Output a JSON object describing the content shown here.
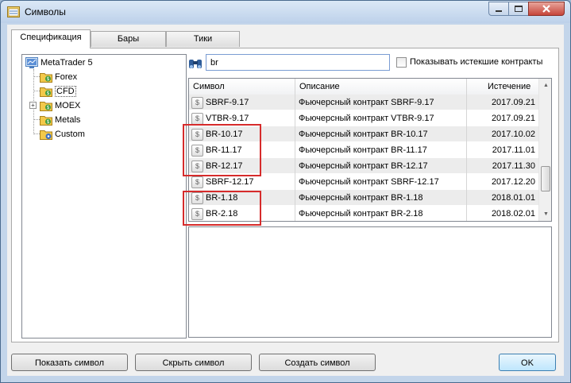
{
  "window": {
    "title": "Символы",
    "close_icon": "close-icon",
    "minimize_icon": "minimize-icon",
    "maximize_icon": "maximize-icon"
  },
  "tabs": [
    {
      "label": "Спецификация",
      "active": true
    },
    {
      "label": "Бары",
      "active": false
    },
    {
      "label": "Тики",
      "active": false
    }
  ],
  "tree": {
    "root": {
      "label": "MetaTrader 5",
      "icon": "metatrader-icon"
    },
    "items": [
      {
        "label": "Forex",
        "icon": "folder-dollar-icon",
        "expandable": false
      },
      {
        "label": "CFD",
        "icon": "folder-dollar-icon",
        "expandable": false,
        "selected": true
      },
      {
        "label": "MOEX",
        "icon": "folder-dollar-icon",
        "expandable": true
      },
      {
        "label": "Metals",
        "icon": "folder-dollar-icon",
        "expandable": false
      },
      {
        "label": "Custom",
        "icon": "folder-custom-icon",
        "expandable": false
      }
    ]
  },
  "search": {
    "value": "br",
    "icon": "binoculars-icon"
  },
  "show_expired": {
    "label": "Показывать истекшие контракты",
    "checked": false
  },
  "table": {
    "columns": [
      "Символ",
      "Описание",
      "Истечение"
    ],
    "rows": [
      {
        "symbol": "SBRF-9.17",
        "description": "Фьючерсный контракт SBRF-9.17",
        "expiration": "2017.09.21"
      },
      {
        "symbol": "VTBR-9.17",
        "description": "Фьючерсный контракт VTBR-9.17",
        "expiration": "2017.09.21"
      },
      {
        "symbol": "BR-10.17",
        "description": "Фьючерсный контракт BR-10.17",
        "expiration": "2017.10.02"
      },
      {
        "symbol": "BR-11.17",
        "description": "Фьючерсный контракт BR-11.17",
        "expiration": "2017.11.01"
      },
      {
        "symbol": "BR-12.17",
        "description": "Фьючерсный контракт BR-12.17",
        "expiration": "2017.11.30"
      },
      {
        "symbol": "SBRF-12.17",
        "description": "Фьючерсный контракт SBRF-12.17",
        "expiration": "2017.12.20"
      },
      {
        "symbol": "BR-1.18",
        "description": "Фьючерсный контракт BR-1.18",
        "expiration": "2018.01.01"
      },
      {
        "symbol": "BR-2.18",
        "description": "Фьючерсный контракт BR-2.18",
        "expiration": "2018.02.01"
      }
    ]
  },
  "buttons": {
    "show_symbol": "Показать символ",
    "hide_symbol": "Скрыть символ",
    "create_symbol": "Создать символ",
    "ok": "OK"
  },
  "colors": {
    "highlight": "#d62b2b",
    "accent": "#3c7fb1"
  }
}
